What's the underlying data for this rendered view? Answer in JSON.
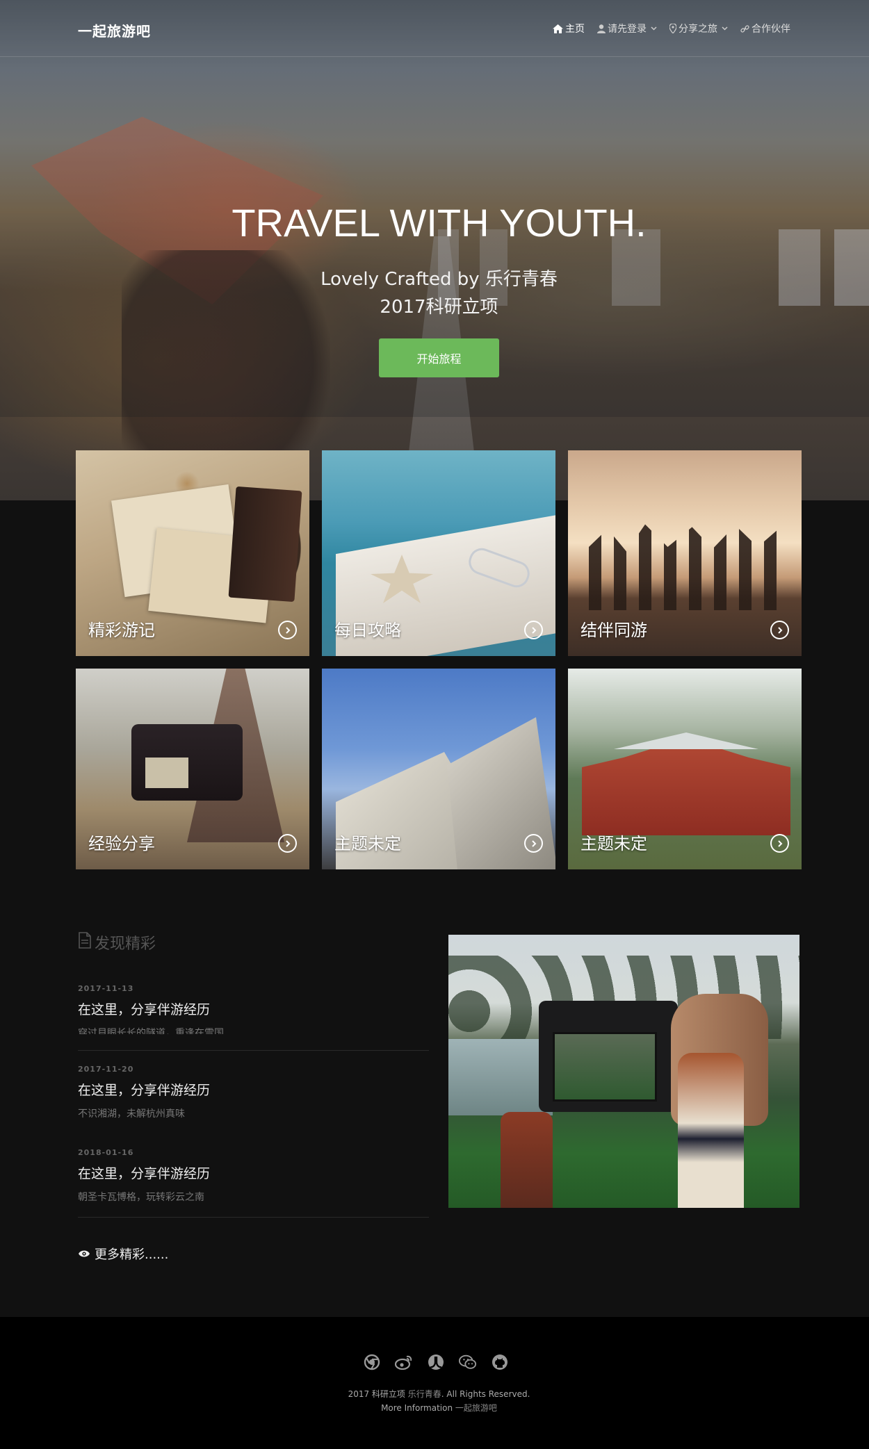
{
  "nav": {
    "brand": "一起旅游吧",
    "links": [
      {
        "label": "主页",
        "icon": "home-icon"
      },
      {
        "label": "请先登录",
        "icon": "user-icon"
      },
      {
        "label": "分享之旅",
        "icon": "map-pin-icon"
      },
      {
        "label": "合作伙伴",
        "icon": "link-icon"
      }
    ]
  },
  "hero": {
    "title": "TRAVEL WITH YOUTH.",
    "subtitle_line1": "Lovely Crafted by 乐行青春",
    "subtitle_line2": "2017科研立项",
    "button": "开始旅程"
  },
  "tiles": [
    {
      "label": "精彩游记"
    },
    {
      "label": "每日攻略"
    },
    {
      "label": "结伴同游"
    },
    {
      "label": "经验分享"
    },
    {
      "label": "主题未定"
    },
    {
      "label": "主题未定"
    }
  ],
  "discover": {
    "heading": "发现精彩",
    "posts": [
      {
        "date": "2017-11-13",
        "title": "在这里，分享伴游经历",
        "desc": "穿过貝眼长长的隧道，重逢在雪国"
      },
      {
        "date": "2017-11-20",
        "title": "在这里，分享伴游经历",
        "desc": "不识湘湖，未解杭州真味"
      },
      {
        "date": "2018-01-16",
        "title": "在这里，分享伴游经历",
        "desc": "朝圣卡瓦博格，玩转彩云之南"
      }
    ],
    "more": "更多精彩......"
  },
  "footer": {
    "social_icons": [
      "chrome-icon",
      "weibo-icon",
      "renren-icon",
      "wechat-icon",
      "github-icon"
    ],
    "line1_prefix": "2017 科研立项 ",
    "line1_highlight": "乐行青春",
    "line1_suffix": ". All Rights Reserved.",
    "line2_prefix": "More Information ",
    "line2_highlight": "一起旅游吧"
  },
  "colors": {
    "accent_green": "#6cb95a",
    "background": "#111111",
    "footer": "#000000"
  }
}
